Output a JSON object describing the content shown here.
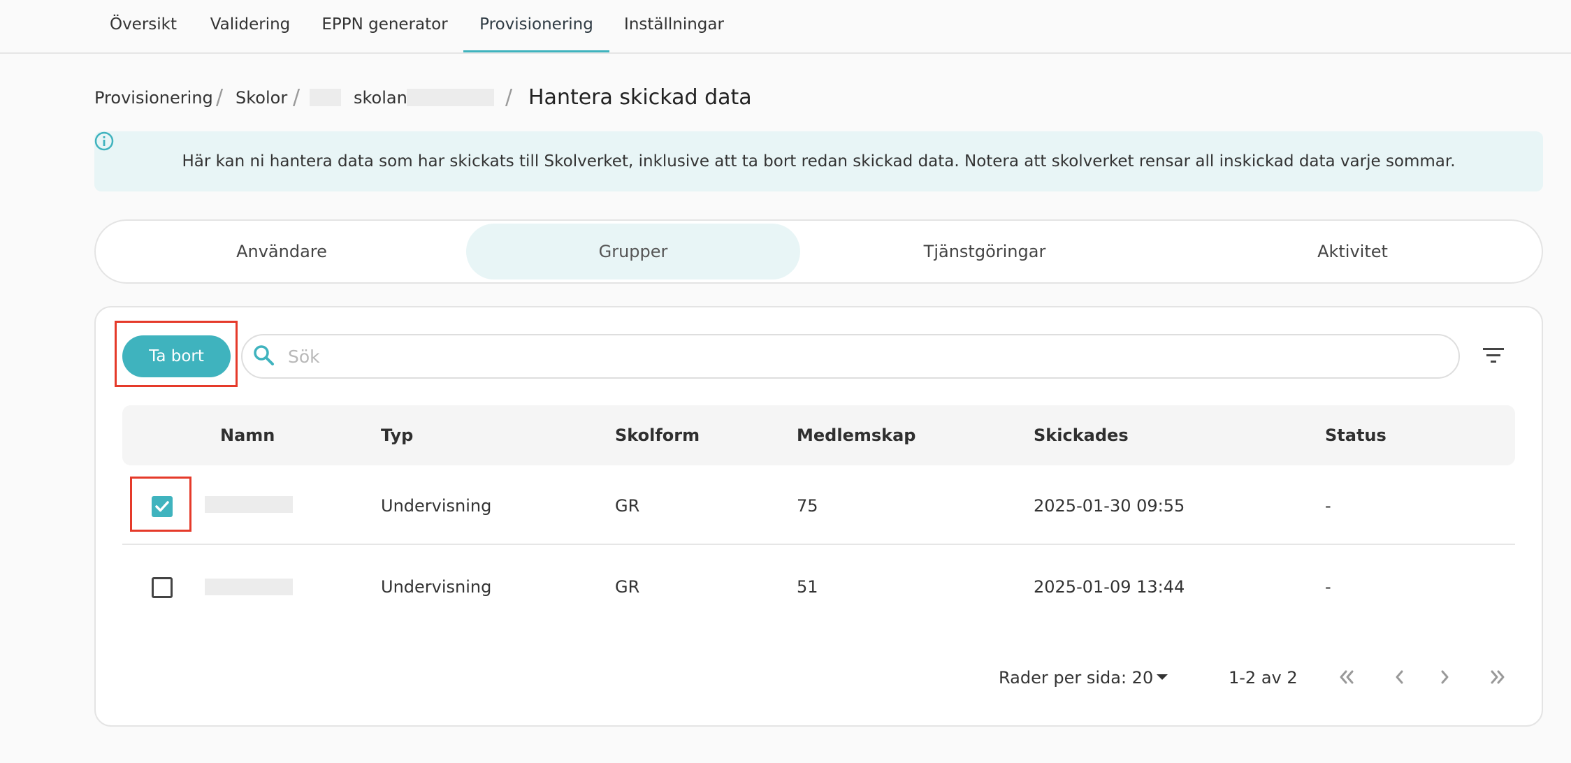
{
  "nav": {
    "tabs": [
      {
        "label": "Översikt"
      },
      {
        "label": "Validering"
      },
      {
        "label": "EPPN generator"
      },
      {
        "label": "Provisionering"
      },
      {
        "label": "Inställningar"
      }
    ],
    "active": "Provisionering"
  },
  "breadcrumb": {
    "items": [
      "Provisionering",
      "Skolor"
    ],
    "school_visible": "skolan",
    "current": "Hantera skickad data",
    "separator": "/"
  },
  "banner": {
    "text": "Här kan ni hantera data som har skickats till Skolverket, inklusive att ta bort redan skickad data. Notera att skolverket rensar all inskickad data varje sommar.",
    "icon": "info-icon"
  },
  "segments": {
    "tabs": [
      "Användare",
      "Grupper",
      "Tjänstgöringar",
      "Aktivitet"
    ],
    "active": "Grupper"
  },
  "toolbar": {
    "delete_label": "Ta bort",
    "search_placeholder": "Sök",
    "search_value": ""
  },
  "table": {
    "headers": [
      "Namn",
      "Typ",
      "Skolform",
      "Medlemskap",
      "Skickades",
      "Status"
    ],
    "rows": [
      {
        "checked": true,
        "name": "",
        "type": "Undervisning",
        "school_form": "GR",
        "members": "75",
        "sent": "2025-01-30 09:55",
        "status": "-"
      },
      {
        "checked": false,
        "name": "",
        "type": "Undervisning",
        "school_form": "GR",
        "members": "51",
        "sent": "2025-01-09 13:44",
        "status": "-"
      }
    ]
  },
  "pagination": {
    "rows_per_page_label": "Rader per sida: 20",
    "range": "1-2 av 2"
  },
  "colors": {
    "accent": "#3fb3be",
    "banner_bg": "#e8f5f6",
    "highlight": "#e53a2a"
  }
}
